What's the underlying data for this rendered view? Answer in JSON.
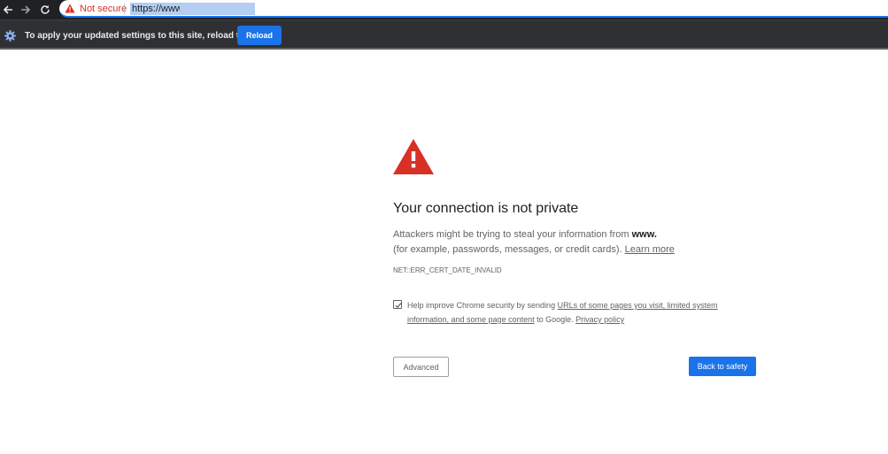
{
  "toolbar": {
    "back_icon": "arrow-left-icon",
    "forward_icon": "arrow-right-icon",
    "reload_icon": "reload-icon"
  },
  "omnibox": {
    "security_icon": "warning-triangle-icon",
    "security_label": "Not secure",
    "url": "https://www."
  },
  "infobar": {
    "icon": "gear-icon",
    "message": "To apply your updated settings to this site, reload this page",
    "reload_label": "Reload"
  },
  "interstitial": {
    "icon": "warning-triangle-icon",
    "heading": "Your connection is not private",
    "body_pre": "Attackers might be trying to steal your information from",
    "domain": "www.",
    "body_post_1": "(for",
    "body_post_2": "example, passwords, messages, or credit cards).",
    "learn_more": "Learn more",
    "error_code": "NET::ERR_CERT_DATE_INVALID",
    "optin": {
      "checked": true,
      "text_pre": "Help improve Chrome security by sending",
      "link1": "URLs of some pages you visit, limited system information, and some page content",
      "text_mid": "to Google.",
      "link2": "Privacy policy"
    },
    "advanced_label": "Advanced",
    "back_to_safety_label": "Back to safety"
  },
  "colors": {
    "accent": "#1a73e8",
    "danger": "#d93025",
    "toolbar_bg": "#202124",
    "infobar_bg": "#2f3033"
  }
}
